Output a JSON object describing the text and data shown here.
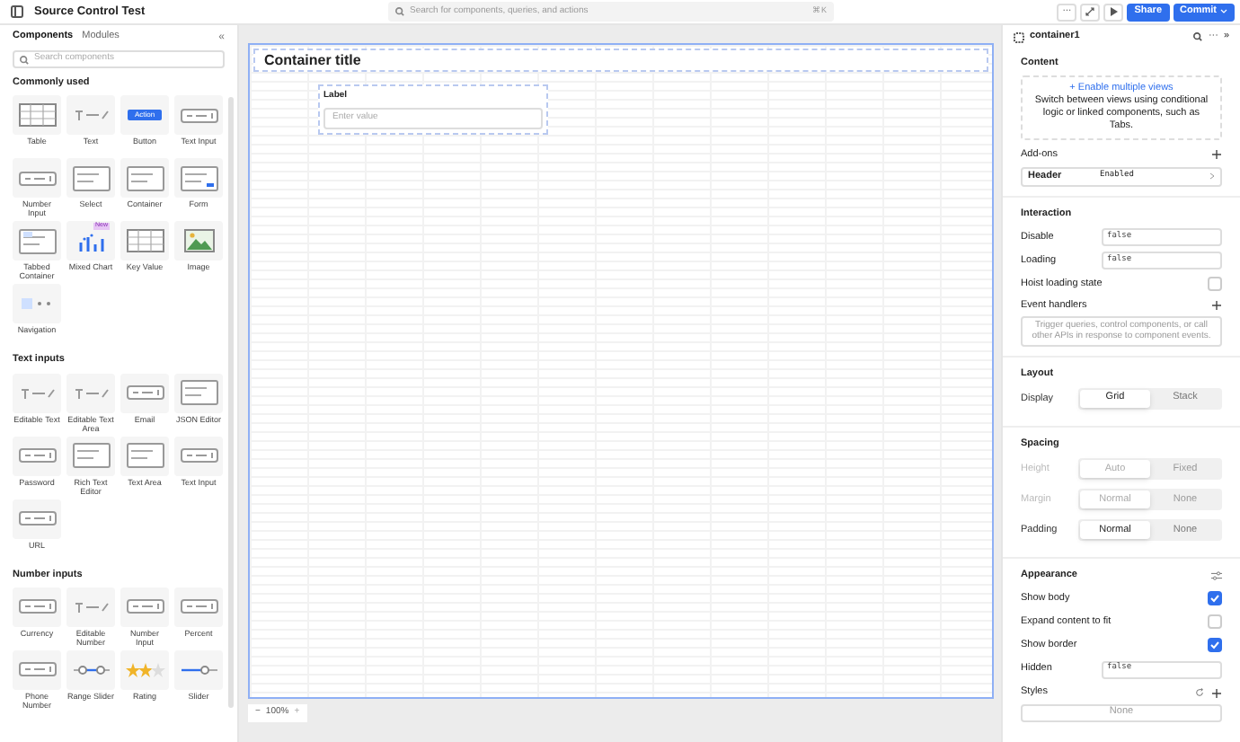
{
  "app": {
    "title": "Source Control Test"
  },
  "topbar": {
    "search_placeholder": "Search for components, queries, and actions",
    "shortcut": "⌘K",
    "more": "···",
    "share": "Share",
    "commit": "Commit"
  },
  "left_panel": {
    "tabs": [
      {
        "label": "Components",
        "selected": true
      },
      {
        "label": "Modules",
        "selected": false
      }
    ],
    "collapse": "«",
    "search_placeholder": "Search components",
    "sections": [
      {
        "title": "Commonly used",
        "items": [
          {
            "label": "Table",
            "kind": "table"
          },
          {
            "label": "Text",
            "kind": "text"
          },
          {
            "label": "Button",
            "kind": "button",
            "button_text": "Action"
          },
          {
            "label": "Text Input",
            "kind": "input"
          },
          {
            "label": "Number Input",
            "kind": "input"
          },
          {
            "label": "Select",
            "kind": "select"
          },
          {
            "label": "Container",
            "kind": "container"
          },
          {
            "label": "Form",
            "kind": "form"
          },
          {
            "label": "Tabbed Container",
            "kind": "tabs"
          },
          {
            "label": "Mixed Chart",
            "kind": "chart",
            "badge": "New"
          },
          {
            "label": "Key Value",
            "kind": "table"
          },
          {
            "label": "Image",
            "kind": "image"
          },
          {
            "label": "Navigation",
            "kind": "nav"
          }
        ]
      },
      {
        "title": "Text inputs",
        "items": [
          {
            "label": "Editable Text",
            "kind": "edit"
          },
          {
            "label": "Editable Text Area",
            "kind": "edit"
          },
          {
            "label": "Email",
            "kind": "input"
          },
          {
            "label": "JSON Editor",
            "kind": "area"
          },
          {
            "label": "Password",
            "kind": "input"
          },
          {
            "label": "Rich Text Editor",
            "kind": "area"
          },
          {
            "label": "Text Area",
            "kind": "area"
          },
          {
            "label": "Text Input",
            "kind": "input"
          },
          {
            "label": "URL",
            "kind": "input"
          }
        ]
      },
      {
        "title": "Number inputs",
        "items": [
          {
            "label": "Currency",
            "kind": "input"
          },
          {
            "label": "Editable Number",
            "kind": "edit"
          },
          {
            "label": "Number Input",
            "kind": "input"
          },
          {
            "label": "Percent",
            "kind": "input"
          },
          {
            "label": "Phone Number",
            "kind": "input"
          },
          {
            "label": "Range Slider",
            "kind": "range"
          },
          {
            "label": "Rating",
            "kind": "rating"
          },
          {
            "label": "Slider",
            "kind": "slider"
          }
        ]
      }
    ]
  },
  "canvas": {
    "container_title": "Container title",
    "field_label": "Label",
    "field_placeholder": "Enter value",
    "zoom": "100%",
    "zoom_out": "−",
    "zoom_in": "+"
  },
  "inspector": {
    "name": "container1",
    "more": "···",
    "collapse": "»",
    "content": {
      "title": "Content",
      "link": "+ Enable multiple views",
      "description": "Switch between views using conditional logic or linked components, such as Tabs.",
      "addons_title": "Add-ons",
      "addon": {
        "name": "Header",
        "value": "Enabled"
      }
    },
    "interaction": {
      "title": "Interaction",
      "fields": [
        {
          "label": "Disable",
          "value": "false"
        },
        {
          "label": "Loading",
          "value": "false"
        }
      ],
      "hoist": {
        "label": "Hoist loading state",
        "checked": false
      },
      "events_title": "Event handlers",
      "events_hint": "Trigger queries, control components, or call other APIs in response to component events."
    },
    "layout": {
      "title": "Layout",
      "rows": [
        {
          "label": "Display",
          "disabled": false,
          "options": [
            {
              "label": "Grid",
              "selected": true
            },
            {
              "label": "Stack",
              "selected": false
            }
          ]
        }
      ]
    },
    "spacing": {
      "title": "Spacing",
      "rows": [
        {
          "label": "Height",
          "disabled": true,
          "options": [
            {
              "label": "Auto",
              "selected": true
            },
            {
              "label": "Fixed",
              "selected": false
            }
          ]
        },
        {
          "label": "Margin",
          "disabled": true,
          "options": [
            {
              "label": "Normal",
              "selected": true
            },
            {
              "label": "None",
              "selected": false
            }
          ]
        },
        {
          "label": "Padding",
          "disabled": false,
          "options": [
            {
              "label": "Normal",
              "selected": true
            },
            {
              "label": "None",
              "selected": false
            }
          ]
        }
      ]
    },
    "appearance": {
      "title": "Appearance",
      "checks": [
        {
          "label": "Show body",
          "checked": true
        },
        {
          "label": "Expand content to fit",
          "checked": false
        },
        {
          "label": "Show border",
          "checked": true
        }
      ],
      "hidden": {
        "label": "Hidden",
        "value": "false"
      },
      "styles_title": "Styles",
      "styles_value": "None"
    }
  }
}
